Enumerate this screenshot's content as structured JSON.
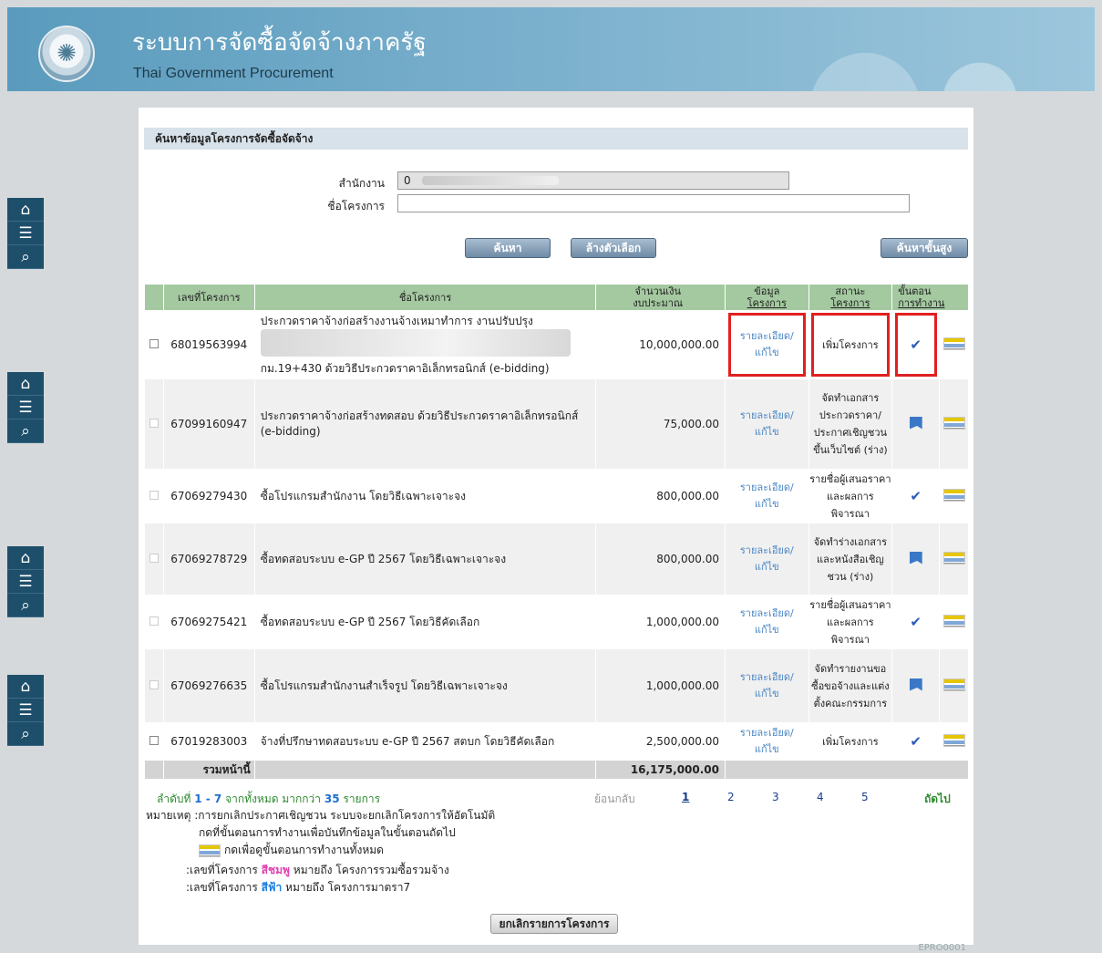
{
  "header": {
    "title_th": "ระบบการจัดซื้อจัดจ้างภาครัฐ",
    "title_en": "Thai Government Procurement",
    "logo_text": "กรมบัญชีกลาง"
  },
  "sidenav_icons": [
    "home-icon",
    "menu-icon",
    "search-icon"
  ],
  "section_title": "ค้นหาข้อมูลโครงการจัดซื้อจัดจ้าง",
  "search": {
    "office_label": "สำนักงาน",
    "office_value": "0",
    "project_label": "ชื่อโครงการ",
    "project_value": "",
    "search_btn": "ค้นหา",
    "clear_btn": "ล้างตัวเลือก",
    "advanced_btn": "ค้นหาขั้นสูง"
  },
  "table": {
    "headers": {
      "project_no": "เลขที่โครงการ",
      "project_name": "ชื่อโครงการ",
      "amount_1": "จำนวนเงิน",
      "amount_2": "งบประมาณ",
      "info_1": "ข้อมูล",
      "info_2": "โครงการ",
      "status_1": "สถานะ",
      "status_2": "โครงการ",
      "step_1": "ขั้นตอน",
      "step_2": "การทำงาน"
    },
    "rows": [
      {
        "no": "68019563994",
        "name_1": "ประกวดราคาจ้างก่อสร้างงานจ้างเหมาทำการ งานปรับปรุง",
        "name_2": "กม.19+430 ด้วยวิธีประกวดราคาอิเล็กทรอนิกส์ (e-bidding)",
        "amount": "10,000,000.00",
        "info_1": "รายละเอียด/",
        "info_2": "แก้ไข",
        "status": "เพิ่มโครงการ"
      },
      {
        "no": "67099160947",
        "name": "ประกวดราคาจ้างก่อสร้างทดสอบ ด้วยวิธีประกวดราคาอิเล็กทรอนิกส์ (e-bidding)",
        "amount": "75,000.00",
        "info_1": "รายละเอียด/",
        "info_2": "แก้ไข",
        "status": "จัดทำเอกสารประกวดราคา/ประกาศเชิญชวนขึ้นเว็บไซต์ (ร่าง)"
      },
      {
        "no": "67069279430",
        "name": "ซื้อโปรแกรมสำนักงาน โดยวิธีเฉพาะเจาะจง",
        "amount": "800,000.00",
        "info_1": "รายละเอียด/",
        "info_2": "แก้ไข",
        "status": "รายชื่อผู้เสนอราคาและผลการพิจารณา"
      },
      {
        "no": "67069278729",
        "name": "ซื้อทดสอบระบบ e-GP ปี 2567 โดยวิธีเฉพาะเจาะจง",
        "amount": "800,000.00",
        "info_1": "รายละเอียด/",
        "info_2": "แก้ไข",
        "status": "จัดทำร่างเอกสารและหนังสือเชิญชวน (ร่าง)"
      },
      {
        "no": "67069275421",
        "name": "ซื้อทดสอบระบบ e-GP ปี 2567 โดยวิธีคัดเลือก",
        "amount": "1,000,000.00",
        "info_1": "รายละเอียด/",
        "info_2": "แก้ไข",
        "status": "รายชื่อผู้เสนอราคาและผลการพิจารณา"
      },
      {
        "no": "67069276635",
        "name": "ซื้อโปรแกรมสำนักงานสำเร็จรูป โดยวิธีเฉพาะเจาะจง",
        "amount": "1,000,000.00",
        "info_1": "รายละเอียด/",
        "info_2": "แก้ไข",
        "status": "จัดทำรายงานขอซื้อขอจ้างและแต่งตั้งคณะกรรมการ"
      },
      {
        "no": "67019283003",
        "name": "จ้างที่ปรึกษาทดสอบระบบ e-GP ปี 2567 สตบก โดยวิธีคัดเลือก",
        "amount": "2,500,000.00",
        "info_1": "รายละเอียด/",
        "info_2": "แก้ไข",
        "status": "เพิ่มโครงการ"
      }
    ],
    "total_label": "รวมหน้านี้",
    "total_amount": "16,175,000.00"
  },
  "pagination": {
    "summary_pre": "ลำดับที่",
    "summary_range": "1 - 7",
    "summary_mid": "จากทั้งหมด มากกว่า",
    "summary_count": "35",
    "summary_post": "รายการ",
    "back": "ย้อนกลับ",
    "pages": [
      "1",
      "2",
      "3",
      "4",
      "5"
    ],
    "next": "ถัดไป"
  },
  "notes": {
    "note_label": "หมายเหตุ :",
    "note_1": "การยกเลิกประกาศเชิญชวน ระบบจะยกเลิกโครงการให้อัตโนมัติ",
    "note_2": "กดที่ขั้นตอนการทำงานเพื่อบันทึกข้อมูลในขั้นตอนถัดไป",
    "note_3": "กดเพื่อดูขั้นตอนการทำงานทั้งหมด",
    "note_4_pre": ":เลขที่โครงการ",
    "note_4_color": "สีชมพู",
    "note_4_post": "หมายถึง โครงการรวมซื้อรวมจ้าง",
    "note_5_pre": ":เลขที่โครงการ",
    "note_5_color": "สีฟ้า",
    "note_5_post": "หมายถึง โครงการมาตรา7"
  },
  "cancel_btn": "ยกเลิกรายการโครงการ",
  "footer_code": "EPRO0001",
  "colors": {
    "pink": "#e040b0",
    "blue": "#1e7fe0",
    "link": "#4a86c5",
    "green": "#2f8a2f"
  }
}
